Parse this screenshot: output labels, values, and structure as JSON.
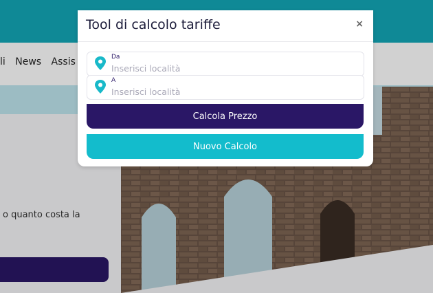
{
  "background": {
    "nav_items": [
      "li",
      "News",
      "Assis"
    ],
    "body_text": "o quanto costa la"
  },
  "modal": {
    "title": "Tool di calcolo tariffe",
    "close_symbol": "×",
    "from": {
      "label": "Da",
      "placeholder": "Inserisci località"
    },
    "to": {
      "label": "A",
      "placeholder": "Inserisci località"
    },
    "calculate_label": "Calcola Prezzo",
    "new_label": "Nuovo Calcolo"
  },
  "colors": {
    "primary_purple": "#2a1766",
    "teal": "#13bccc",
    "pin_teal": "#19b9c9"
  },
  "icons": {
    "location": "map-pin-icon",
    "close": "close-icon"
  }
}
